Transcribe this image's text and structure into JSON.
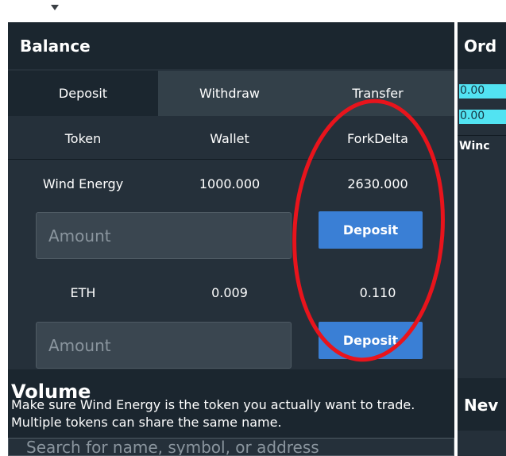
{
  "balance": {
    "title": "Balance",
    "tabs": [
      {
        "label": "Deposit",
        "active": true
      },
      {
        "label": "Withdraw",
        "active": false
      },
      {
        "label": "Transfer",
        "active": false
      }
    ],
    "columns": [
      "Token",
      "Wallet",
      "ForkDelta"
    ],
    "rows": [
      {
        "token": "Wind Energy",
        "wallet": "1000.000",
        "forkdelta": "2630.000",
        "amount_placeholder": "Amount",
        "button_label": "Deposit"
      },
      {
        "token": "ETH",
        "wallet": "0.009",
        "forkdelta": "0.110",
        "amount_placeholder": "Amount",
        "button_label": "Deposit"
      }
    ]
  },
  "volume": {
    "title": "Volume",
    "hint_prefix": "Make sure ",
    "hint_link": "Wind Energy",
    "hint_suffix": " is the token you actually want to trade. Multiple tokens can share the same name.",
    "search_placeholder": "Search for name, symbol, or address"
  },
  "orders": {
    "title": "Ord",
    "values": [
      "0.00",
      "0.00"
    ],
    "column_label": "Winc",
    "news_title": "Nev"
  },
  "colors": {
    "panel_bg": "#25303a",
    "header_bg": "#1b262f",
    "accent_button": "#3a7fd5",
    "highlight_cyan": "#52e3f2",
    "annotation_red": "#e8141c"
  },
  "annotation": {
    "shape": "ellipse",
    "color": "red"
  }
}
